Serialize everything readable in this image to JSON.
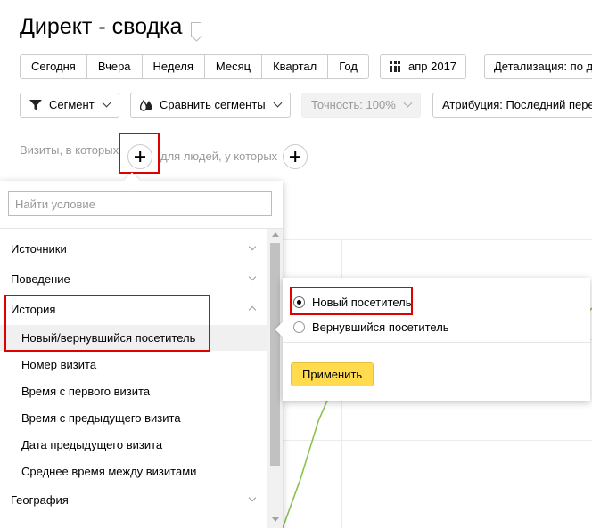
{
  "page": {
    "title": "Директ - сводка"
  },
  "period": {
    "options": [
      "Сегодня",
      "Вчера",
      "Неделя",
      "Месяц",
      "Квартал",
      "Год"
    ]
  },
  "date": {
    "label": "апр 2017"
  },
  "detail": {
    "label": "Детализация: по д"
  },
  "toolbar": {
    "segment_label": "Сегмент",
    "compare_label": "Сравнить сегменты",
    "accuracy_label": "Точность: 100%",
    "attribution_label": "Атрибуция: Последний перех"
  },
  "conditions": {
    "visits_label": "Визиты, в которых",
    "people_label": "для людей, у которых"
  },
  "dropdown": {
    "search_placeholder": "Найти условие",
    "categories": {
      "sources": "Источники",
      "behavior": "Поведение",
      "history": "История",
      "geography": "География"
    },
    "history_items": [
      "Новый/вернувшийся посетитель",
      "Номер визита",
      "Время с первого визита",
      "Время с предыдущего визита",
      "Дата предыдущего визита",
      "Среднее время между визитами"
    ]
  },
  "popover": {
    "options": [
      "Новый посетитель",
      "Вернувшийся посетитель"
    ],
    "selected": "Новый посетитель",
    "apply_label": "Применить"
  },
  "colors": {
    "highlight": "#e00000",
    "apply_button": "#ffdb4d",
    "chart_line": "#8cc152"
  },
  "icons": {
    "title_bookmark": "bookmark-icon",
    "date": "calendar-grid-icon",
    "segment": "filter-icon",
    "compare": "drops-icon"
  }
}
